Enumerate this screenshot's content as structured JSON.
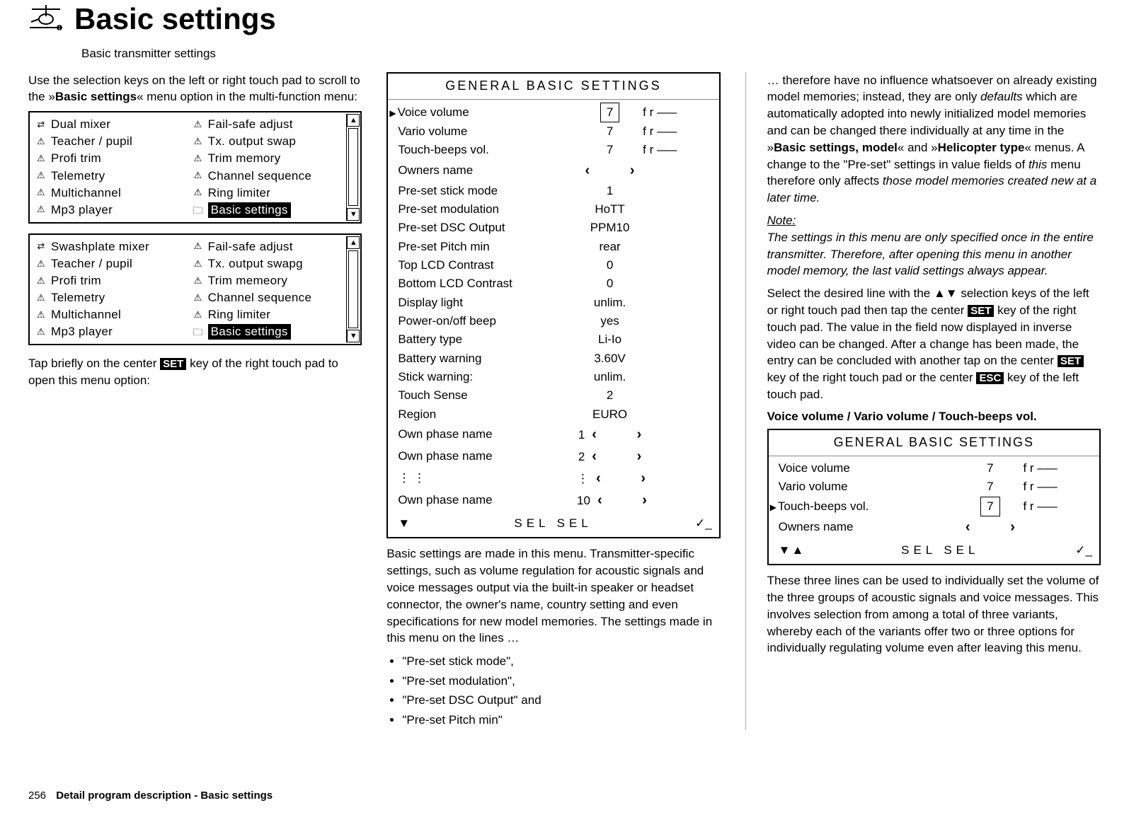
{
  "header": {
    "title": "Basic settings",
    "subtitle": "Basic transmitter settings"
  },
  "col1": {
    "intro": "Use the selection keys on the left or right touch pad to scroll to the »",
    "intro_bold": "Basic settings",
    "intro_tail": "« menu option in the multi-function menu:",
    "menu1": {
      "left": [
        "Dual mixer",
        "Teacher / pupil",
        "Profi trim",
        "Telemetry",
        "Multichannel",
        "Mp3  player"
      ],
      "right": [
        "Fail-safe adjust",
        "Tx. output swap",
        "Trim memory",
        "Channel sequence",
        "Ring limiter",
        "Basic settings"
      ]
    },
    "menu2": {
      "left": [
        "Swashplate mixer",
        "Teacher / pupil",
        "Profi trim",
        "Telemetry",
        "Multichannel",
        "Mp3  player"
      ],
      "right": [
        "Fail-safe adjust",
        "Tx. output swapg",
        "Trim memeory",
        "Channel sequence",
        "Ring limiter",
        "Basic settings"
      ]
    },
    "tap_a": "Tap briefly on the center ",
    "tap_key": "SET",
    "tap_b": " key of the right touch pad to open this menu option:"
  },
  "col2": {
    "lcd_title": "GENERAL BASIC SETTINGS",
    "rows": [
      {
        "label": "Voice volume",
        "val": "7",
        "boxed": true,
        "extra": "f r   –––",
        "marker": true
      },
      {
        "label": "Vario volume",
        "val": "7",
        "extra": "f r   –––"
      },
      {
        "label": "Touch-beeps vol.",
        "val": "7",
        "extra": "f r   –––"
      },
      {
        "label": "Owners name",
        "angle": true
      },
      {
        "label": "Pre-set stick mode",
        "val": "1"
      },
      {
        "label": "Pre-set modulation",
        "val": "HoTT"
      },
      {
        "label": "Pre-set DSC Output",
        "val": "PPM10"
      },
      {
        "label": "Pre-set  Pitch min",
        "val": "rear"
      },
      {
        "label": "Top LCD Contrast",
        "val": "0"
      },
      {
        "label": "Bottom LCD Contrast",
        "val": "0"
      },
      {
        "label": "Display light",
        "val": "unlim."
      },
      {
        "label": "Power-on/off beep",
        "val": "yes"
      },
      {
        "label": "Battery type",
        "val": "Li-Io"
      },
      {
        "label": "Battery warning",
        "val": "3.60V"
      },
      {
        "label": "Stick warning:",
        "val": "unlim."
      },
      {
        "label": "Touch Sense",
        "val": "2"
      },
      {
        "label": "Region",
        "val": "EURO"
      },
      {
        "label": "Own phase name",
        "pre": "1",
        "angle": true
      },
      {
        "label": "Own phase name",
        "pre": "2",
        "angle": true
      },
      {
        "label": "⋮              ⋮",
        "pre": "⋮",
        "angle": true
      },
      {
        "label": "Own phase name",
        "pre": "10",
        "angle": true
      }
    ],
    "bottom_sel": "SEL   SEL",
    "para": "Basic settings are made in this menu. Transmitter-specific settings, such as volume regulation for acoustic signals and voice messages output via the built-in speaker or headset connector, the owner's name, country setting and even specifications for new model memories. The settings made in this menu on the lines …",
    "bullets": [
      "\"Pre-set stick mode\",",
      "\"Pre-set modulation\",",
      "\"Pre-set DSC Output\" and",
      "\"Pre-set Pitch min\""
    ]
  },
  "col3": {
    "p1a": "… therefore have no influence whatsoever on already existing model memories; instead, they are only ",
    "p1it": "defaults",
    "p1b": " which are automatically adopted into newly initialized model memories and can be changed there individually at any time in the »",
    "p1bold1": "Basic settings, model",
    "p1c": "« and »",
    "p1bold2": "Helicopter type",
    "p1d": "« menus. A change to the \"Pre-set\" settings in value fields of ",
    "p1it2": "this",
    "p1e": " menu therefore only affects ",
    "p1it3": "those model memories created new at a later time.",
    "note_label": "Note:",
    "note_body": "The settings in this menu are only specified once in the entire transmitter. Therefore, after opening this menu in another model memory, the last valid settings always appear.",
    "p2a": "Select the desired line with the ▲▼ selection keys of the left or right touch pad then tap the center ",
    "p2key1": "SET",
    "p2b": " key of the right touch pad. The value in the field now displayed in inverse video can be changed. After a change has been made, the entry can be concluded with another tap on the center ",
    "p2key2": "SET",
    "p2c": " key of the right touch pad or the center ",
    "p2key3": "ESC",
    "p2d": " key of the left touch pad.",
    "sec_title": "Voice volume / Vario volume / Touch-beeps vol.",
    "lcd2_title": "GENERAL BASIC SETTINGS",
    "lcd2_rows": [
      {
        "label": "Voice volume",
        "val": "7",
        "extra": "f r   –––"
      },
      {
        "label": "Vario volume",
        "val": "7",
        "extra": "f r   –––"
      },
      {
        "label": "Touch-beeps vol.",
        "val": "7",
        "boxed": true,
        "extra": "f r   –––",
        "marker": true
      },
      {
        "label": "Owners name",
        "angle": true
      }
    ],
    "lcd2_sel": "SEL   SEL",
    "p3": "These three lines can be used to individually set the volume of the three groups of acoustic signals and voice messages. This involves selection from among a total of three variants, whereby each of the variants offer two or three options for individually regulating volume even after leaving this menu."
  },
  "footer": {
    "page": "256",
    "text": "Detail program description - Basic settings"
  }
}
